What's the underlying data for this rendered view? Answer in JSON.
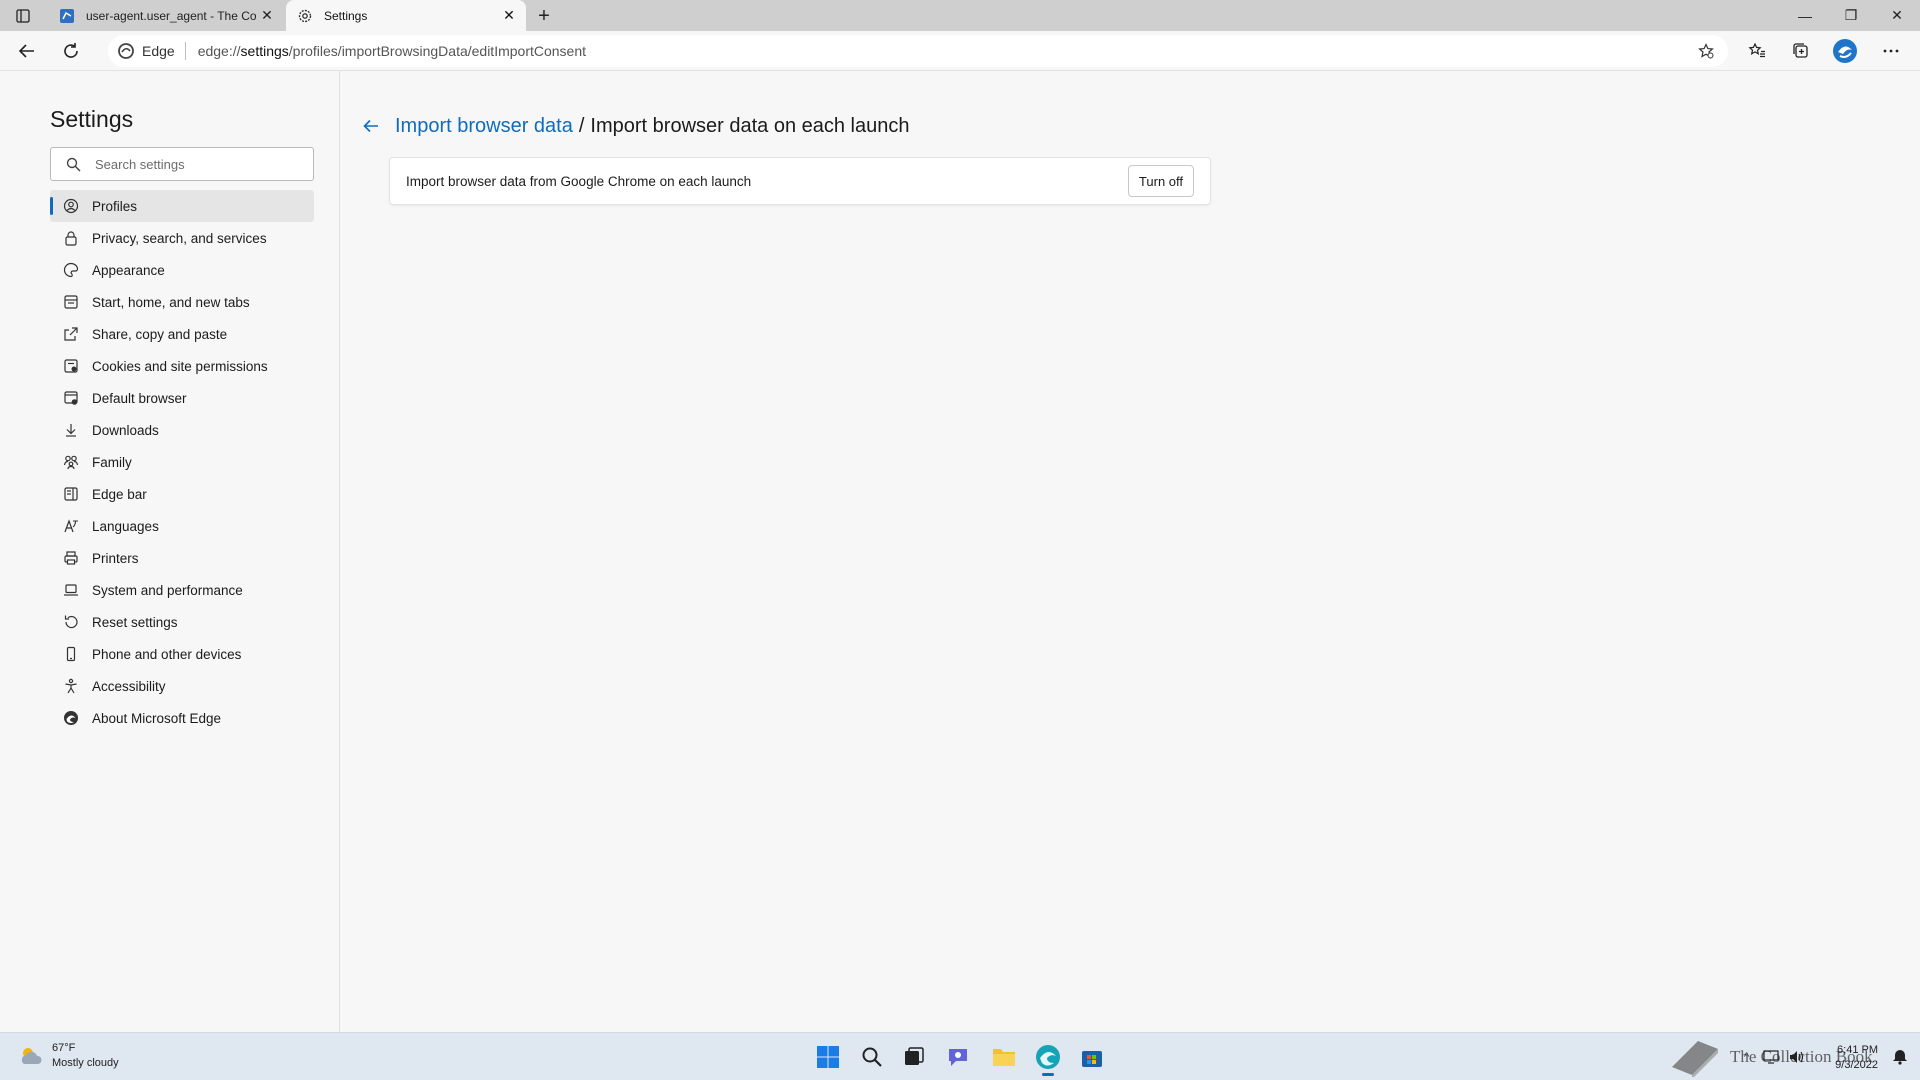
{
  "browser": {
    "tabs": [
      {
        "title": "user-agent.user_agent - The Coll",
        "icon": "book-icon",
        "active": false
      },
      {
        "title": "Settings",
        "icon": "gear-icon",
        "active": true
      }
    ],
    "address": {
      "site_label": "Edge",
      "url_prefix": "edge://",
      "url_host": "settings",
      "url_path": "/profiles/importBrowsingData/editImportConsent"
    }
  },
  "sidebar": {
    "title": "Settings",
    "search_placeholder": "Search settings",
    "items": [
      {
        "label": "Profiles",
        "icon": "profile-icon"
      },
      {
        "label": "Privacy, search, and services",
        "icon": "lock-icon"
      },
      {
        "label": "Appearance",
        "icon": "palette-icon"
      },
      {
        "label": "Start, home, and new tabs",
        "icon": "home-icon"
      },
      {
        "label": "Share, copy and paste",
        "icon": "share-icon"
      },
      {
        "label": "Cookies and site permissions",
        "icon": "permissions-icon"
      },
      {
        "label": "Default browser",
        "icon": "browser-icon"
      },
      {
        "label": "Downloads",
        "icon": "download-icon"
      },
      {
        "label": "Family",
        "icon": "family-icon"
      },
      {
        "label": "Edge bar",
        "icon": "edgebar-icon"
      },
      {
        "label": "Languages",
        "icon": "language-icon"
      },
      {
        "label": "Printers",
        "icon": "printer-icon"
      },
      {
        "label": "System and performance",
        "icon": "laptop-icon"
      },
      {
        "label": "Reset settings",
        "icon": "reset-icon"
      },
      {
        "label": "Phone and other devices",
        "icon": "phone-icon"
      },
      {
        "label": "Accessibility",
        "icon": "accessibility-icon"
      },
      {
        "label": "About Microsoft Edge",
        "icon": "edge-icon"
      }
    ]
  },
  "main": {
    "breadcrumb_parent": "Import browser data",
    "breadcrumb_separator": "/",
    "breadcrumb_current": "Import browser data on each launch",
    "setting_text": "Import browser data from Google Chrome on each launch",
    "setting_button": "Turn off"
  },
  "taskbar": {
    "weather_temp": "67°F",
    "weather_desc": "Mostly cloudy",
    "time": "6:41 PM",
    "date": "9/3/2022",
    "watermark": "The Collection Book"
  },
  "colors": {
    "accent": "#0f6cbd",
    "background": "#f7f7f7",
    "tabbar": "#cfcfcf"
  }
}
